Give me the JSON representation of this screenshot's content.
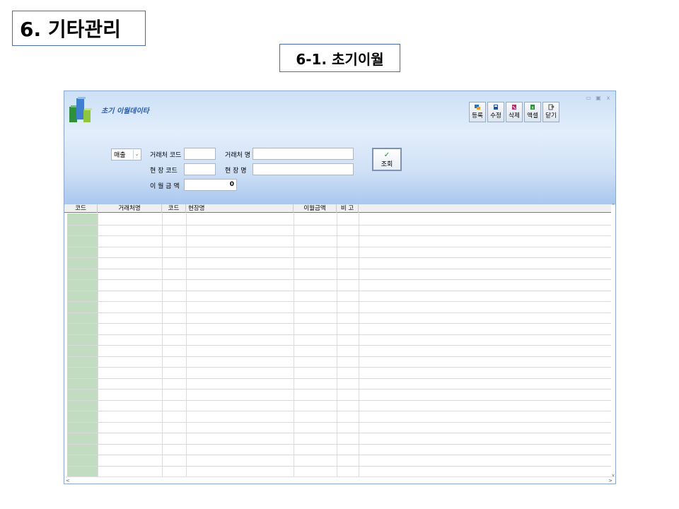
{
  "slide": {
    "title": "6. 기타관리",
    "subtitle": "6-1. 초기이월"
  },
  "window": {
    "title": "초기 이월데이타",
    "controls": {
      "minimize": "▭",
      "restore": "▣",
      "close": "x"
    }
  },
  "toolbar": [
    {
      "name": "register-button",
      "label": "등록",
      "icon": "register-icon",
      "icon_color": "#2f6fb8"
    },
    {
      "name": "edit-button",
      "label": "수정",
      "icon": "save-icon",
      "icon_color": "#1f4fa0"
    },
    {
      "name": "delete-button",
      "label": "삭제",
      "icon": "delete-icon",
      "icon_color": "#b03070"
    },
    {
      "name": "excel-button",
      "label": "액셀",
      "icon": "excel-icon",
      "icon_color": "#2e8b3a"
    },
    {
      "name": "close-button",
      "label": "닫기",
      "icon": "exit-icon",
      "icon_color": "#6a6a6a"
    }
  ],
  "filters": {
    "category_select": {
      "value": "매출"
    },
    "client_code_label": "거래처 코드",
    "client_code_value": "",
    "client_name_label": "거래처 명",
    "client_name_value": "",
    "site_code_label": "현 장 코드",
    "site_code_value": "",
    "site_name_label": "현 장 명",
    "site_name_value": "",
    "carryover_amount_label": "이 월 금 액",
    "carryover_amount_value": "0"
  },
  "query_button": {
    "check": "✓",
    "label": "조회"
  },
  "grid": {
    "columns": [
      "코드",
      "거래처명",
      "코드",
      "현장명",
      "이월금액",
      "비 고"
    ],
    "rows": []
  },
  "colors": {
    "header_gradient_top": "#cde0f7",
    "panel_gradient_bottom": "#a9c7ee",
    "code_column": "#c1dcc0",
    "title_text": "#2a5db0"
  }
}
